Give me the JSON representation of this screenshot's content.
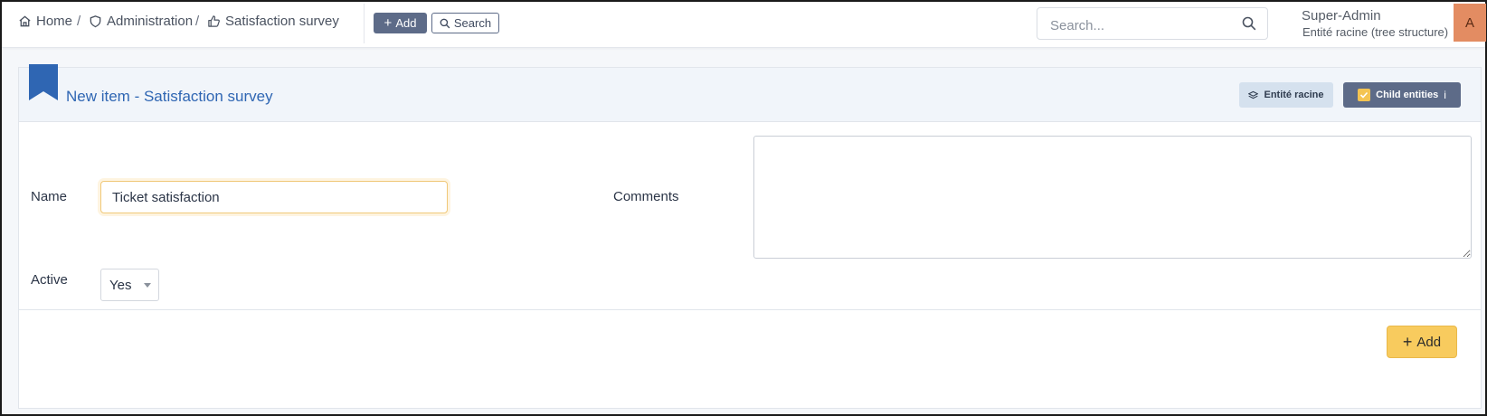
{
  "breadcrumb": {
    "items": [
      {
        "label": "Home",
        "icon": "home-icon"
      },
      {
        "label": "Administration",
        "icon": "shield-icon"
      },
      {
        "label": "Satisfaction survey",
        "icon": "thumbs-up-icon"
      }
    ],
    "separator": "/"
  },
  "toolbar": {
    "add_label": "Add",
    "search_label": "Search"
  },
  "global_search": {
    "placeholder": "Search...",
    "value": ""
  },
  "user": {
    "name": "Super-Admin",
    "entity": "Entité racine (tree structure)",
    "avatar_letter": "A"
  },
  "card": {
    "title": "New item - Satisfaction survey",
    "entity_badge": "Entité racine",
    "child_entities_badge": "Child entities",
    "child_entities_checked": true,
    "info_glyph": "i"
  },
  "form": {
    "name_label": "Name",
    "name_value": "Ticket satisfaction",
    "comments_label": "Comments",
    "comments_value": "",
    "active_label": "Active",
    "active_value": "Yes",
    "submit_label": "Add"
  },
  "colors": {
    "accent": "#2f66b3",
    "toolbar_button": "#5d6b88",
    "submit_button": "#f8cb5e",
    "avatar": "#e38c62"
  }
}
